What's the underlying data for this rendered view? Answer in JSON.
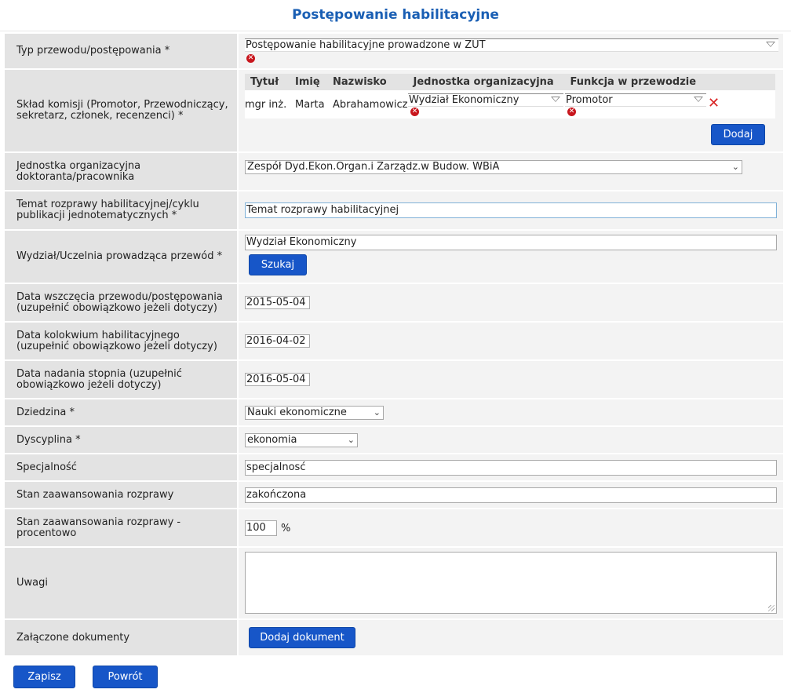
{
  "page": {
    "title": "Postępowanie habilitacyjne"
  },
  "colors": {
    "accent": "#1756c8",
    "title": "#1a5fb4",
    "error": "#c8161d",
    "label_bg": "#e3e3e3",
    "value_bg": "#f3f3f3"
  },
  "fields": {
    "typ": {
      "label": "Typ przewodu/postępowania *",
      "value": "Postępowanie habilitacyjne prowadzone w ZUT"
    },
    "komisja": {
      "label": "Skład komisji (Promotor, Przewodniczący,\nsekretarz, członek, recenzenci) *",
      "columns": [
        "Tytuł",
        "Imię",
        "Nazwisko",
        "Jednostka organizacyjna",
        "Funkcja w przewodzie"
      ],
      "rows": [
        {
          "tytul": "mgr inż.",
          "imie": "Marta",
          "nazwisko": "Abrahamowicz",
          "jednostka": "Wydział Ekonomiczny",
          "funkcja": "Promotor"
        }
      ],
      "add_label": "Dodaj"
    },
    "jednostka": {
      "label": "Jednostka organizacyjna\ndoktoranta/pracownika",
      "value": "Zespół Dyd.Ekon.Organ.i Zarządz.w Budow. WBiA"
    },
    "temat": {
      "label": "Temat rozprawy habilitacyjnej/cyklu\npublikacji jednotematycznych *",
      "value": "Temat rozprawy habilitacyjnej"
    },
    "wydzial": {
      "label": "Wydział/Uczelnia prowadząca przewód *",
      "value": "Wydział Ekonomiczny",
      "search_label": "Szukaj"
    },
    "data_wszczecia": {
      "label": "Data wszczęcia przewodu/postępowania\n(uzupełnić obowiązkowo jeżeli dotyczy)",
      "value": "2015-05-04"
    },
    "data_kolokwium": {
      "label": "Data kolokwium habilitacyjnego\n(uzupełnić obowiązkowo jeżeli dotyczy)",
      "value": "2016-04-02"
    },
    "data_nadania": {
      "label": "Data nadania stopnia (uzupełnić\nobowiązkowo jeżeli dotyczy)",
      "value": "2016-05-04"
    },
    "dziedzina": {
      "label": "Dziedzina *",
      "value": "Nauki ekonomiczne"
    },
    "dyscyplina": {
      "label": "Dyscyplina *",
      "value": "ekonomia"
    },
    "specjalnosc": {
      "label": "Specjalność",
      "value": "specjalnosć"
    },
    "stan": {
      "label": "Stan zaawansowania rozprawy",
      "value": "zakończona"
    },
    "stan_procent": {
      "label": "Stan zaawansowania rozprawy -\nprocentowo",
      "value": "100",
      "unit": "%"
    },
    "uwagi": {
      "label": "Uwagi",
      "value": ""
    },
    "dokumenty": {
      "label": "Załączone dokumenty",
      "add_label": "Dodaj dokument"
    }
  },
  "actions": {
    "save_label": "Zapisz",
    "back_label": "Powrót"
  }
}
